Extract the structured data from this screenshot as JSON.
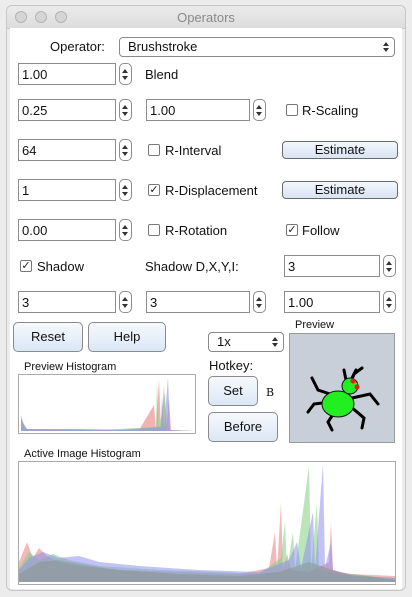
{
  "window": {
    "title": "Operators"
  },
  "operator": {
    "label": "Operator:",
    "value": "Brushstroke"
  },
  "row1": {
    "value": "1.00",
    "label": "Blend"
  },
  "row2": {
    "value_a": "0.25",
    "value_b": "1.00",
    "rscaling_label": "R-Scaling",
    "rscaling_checked": false
  },
  "row3": {
    "value": "64",
    "rinterval_label": "R-Interval",
    "rinterval_checked": false,
    "estimate_label": "Estimate"
  },
  "row4": {
    "value": "1",
    "rdisplacement_label": "R-Displacement",
    "rdisplacement_checked": true,
    "estimate_label": "Estimate"
  },
  "row5": {
    "value": "0.00",
    "rrotation_label": "R-Rotation",
    "rrotation_checked": false,
    "follow_label": "Follow",
    "follow_checked": true
  },
  "row6": {
    "shadow_label": "Shadow",
    "shadow_checked": true,
    "shadow_dxyi_label": "Shadow D,X,Y,I:",
    "value_c": "3"
  },
  "row7": {
    "value_a": "3",
    "value_b": "3",
    "value_c": "1.00"
  },
  "buttons": {
    "reset": "Reset",
    "help": "Help",
    "set": "Set",
    "before": "Before"
  },
  "zoom": {
    "value": "1x"
  },
  "hotkey": {
    "label": "Hotkey:",
    "key": "B"
  },
  "preview": {
    "label": "Preview"
  },
  "preview_histogram": {
    "label": "Preview Histogram"
  },
  "active_histogram": {
    "label": "Active Image Histogram"
  },
  "colors": {
    "button_top": "#f6f9fd",
    "button_bottom": "#dbe7f5",
    "hist_red": "#e88080",
    "hist_green": "#7fd07f",
    "hist_blue": "#8f8fef",
    "bug_green": "#22ee22"
  },
  "checkmark": "✓"
}
